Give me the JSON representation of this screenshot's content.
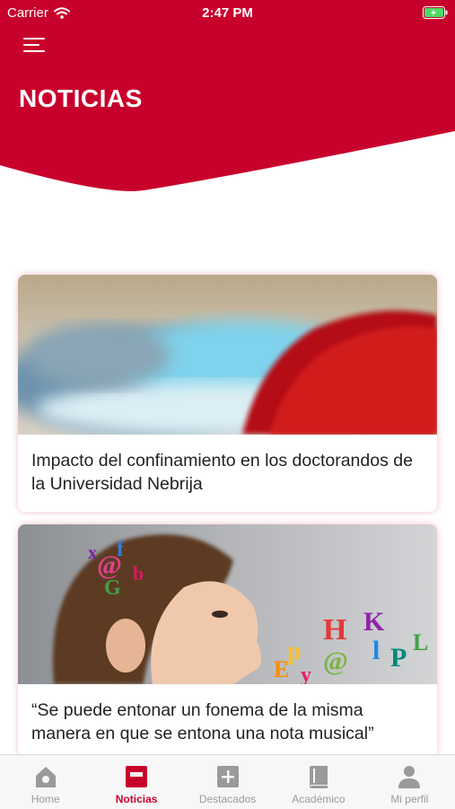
{
  "status_bar": {
    "carrier": "Carrier",
    "time": "2:47 PM"
  },
  "header": {
    "title": "NOTICIAS"
  },
  "colors": {
    "brand": "#c8002c",
    "tab_inactive": "#9a9a9a"
  },
  "news": [
    {
      "title": "Impacto del confinamiento en los doctorandos de la Universidad Nebrija"
    },
    {
      "title": "“Se puede entonar un fonema de la misma manera en que se entona una nota musical”"
    }
  ],
  "tabs": [
    {
      "label": "Home",
      "icon": "home-icon"
    },
    {
      "label": "Noticias",
      "icon": "news-icon",
      "active": true
    },
    {
      "label": "Destacados",
      "icon": "plus-icon"
    },
    {
      "label": "Académico",
      "icon": "book-icon"
    },
    {
      "label": "Mi perfil",
      "icon": "user-icon"
    }
  ]
}
